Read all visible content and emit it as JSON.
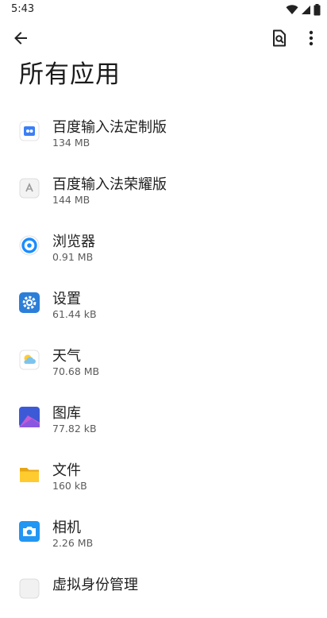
{
  "status_bar": {
    "time": "5:43"
  },
  "toolbar": {
    "back_icon": "back-arrow-icon",
    "search_icon": "search-app-icon",
    "more_icon": "more-vert-icon"
  },
  "page": {
    "title": "所有应用"
  },
  "apps": [
    {
      "name": "百度输入法定制版",
      "size": "134 MB",
      "icon": "baidu-ime-custom-icon"
    },
    {
      "name": "百度输入法荣耀版",
      "size": "144 MB",
      "icon": "baidu-ime-honor-icon"
    },
    {
      "name": "浏览器",
      "size": "0.91 MB",
      "icon": "browser-icon"
    },
    {
      "name": "设置",
      "size": "61.44 kB",
      "icon": "settings-icon"
    },
    {
      "name": "天气",
      "size": "70.68 MB",
      "icon": "weather-icon"
    },
    {
      "name": "图库",
      "size": "77.82 kB",
      "icon": "gallery-icon"
    },
    {
      "name": "文件",
      "size": "160 kB",
      "icon": "files-icon"
    },
    {
      "name": "相机",
      "size": "2.26 MB",
      "icon": "camera-icon"
    },
    {
      "name": "虚拟身份管理",
      "size": "",
      "icon": "virtual-identity-icon"
    }
  ]
}
